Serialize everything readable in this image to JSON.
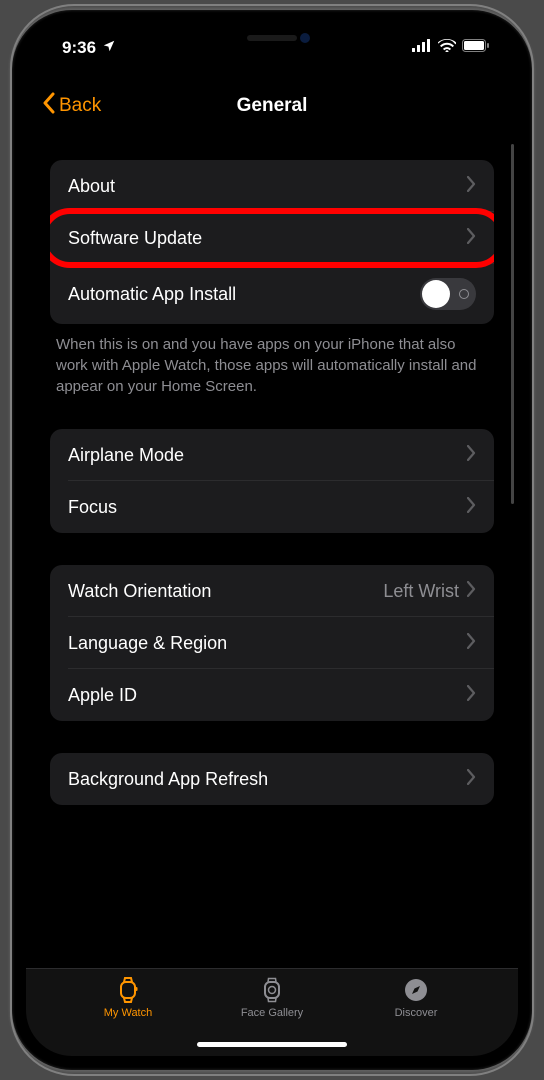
{
  "statusbar": {
    "time": "9:36"
  },
  "nav": {
    "back_label": "Back",
    "title": "General"
  },
  "groups": [
    {
      "rows": [
        {
          "label": "About",
          "type": "disclosure"
        },
        {
          "label": "Software Update",
          "type": "disclosure",
          "highlighted": true
        },
        {
          "label": "Automatic App Install",
          "type": "toggle",
          "value": false
        }
      ],
      "description": "When this is on and you have apps on your iPhone that also work with Apple Watch, those apps will automatically install and appear on your Home Screen."
    },
    {
      "rows": [
        {
          "label": "Airplane Mode",
          "type": "disclosure"
        },
        {
          "label": "Focus",
          "type": "disclosure"
        }
      ]
    },
    {
      "rows": [
        {
          "label": "Watch Orientation",
          "type": "disclosure",
          "detail": "Left Wrist"
        },
        {
          "label": "Language & Region",
          "type": "disclosure"
        },
        {
          "label": "Apple ID",
          "type": "disclosure"
        }
      ]
    },
    {
      "rows": [
        {
          "label": "Background App Refresh",
          "type": "disclosure"
        }
      ]
    }
  ],
  "tabs": [
    {
      "label": "My Watch",
      "icon": "watch-outline",
      "active": true
    },
    {
      "label": "Face Gallery",
      "icon": "watch-face",
      "active": false
    },
    {
      "label": "Discover",
      "icon": "compass",
      "active": false
    }
  ]
}
